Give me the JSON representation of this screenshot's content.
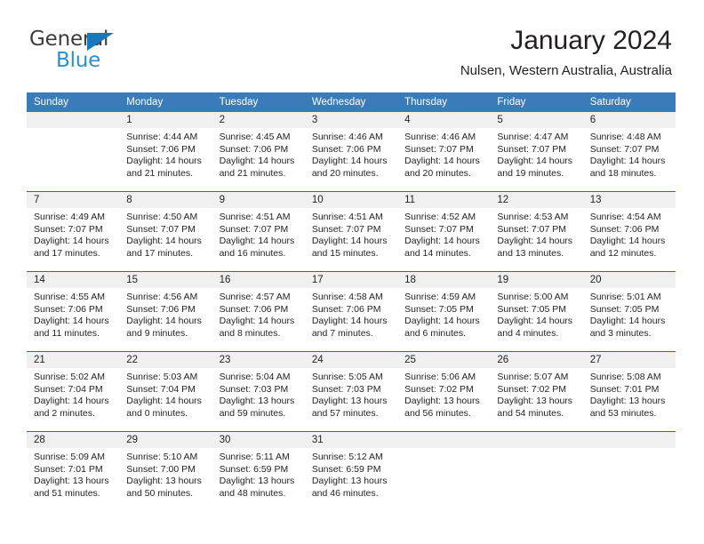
{
  "brand": {
    "name_top": "General",
    "name_bottom": "Blue",
    "logo_icon": "triangle-icon",
    "color_top": "#3d3d3d",
    "color_bottom": "#2b8fd4",
    "accent": "#1878bd"
  },
  "header": {
    "title": "January 2024",
    "subtitle": "Nulsen, Western Australia, Australia"
  },
  "theme": {
    "header_row_bg": "#3a7cba",
    "header_row_text": "#ffffff",
    "daynum_strip_bg": "#f0f0f0",
    "row_divider": "#2b6ca8",
    "body_text": "#231f20"
  },
  "weekdays": [
    "Sunday",
    "Monday",
    "Tuesday",
    "Wednesday",
    "Thursday",
    "Friday",
    "Saturday"
  ],
  "weeks": [
    [
      {
        "day": "",
        "sunrise": "",
        "sunset": "",
        "daylight_line1": "",
        "daylight_line2": ""
      },
      {
        "day": "1",
        "sunrise": "Sunrise: 4:44 AM",
        "sunset": "Sunset: 7:06 PM",
        "daylight_line1": "Daylight: 14 hours",
        "daylight_line2": "and 21 minutes."
      },
      {
        "day": "2",
        "sunrise": "Sunrise: 4:45 AM",
        "sunset": "Sunset: 7:06 PM",
        "daylight_line1": "Daylight: 14 hours",
        "daylight_line2": "and 21 minutes."
      },
      {
        "day": "3",
        "sunrise": "Sunrise: 4:46 AM",
        "sunset": "Sunset: 7:06 PM",
        "daylight_line1": "Daylight: 14 hours",
        "daylight_line2": "and 20 minutes."
      },
      {
        "day": "4",
        "sunrise": "Sunrise: 4:46 AM",
        "sunset": "Sunset: 7:07 PM",
        "daylight_line1": "Daylight: 14 hours",
        "daylight_line2": "and 20 minutes."
      },
      {
        "day": "5",
        "sunrise": "Sunrise: 4:47 AM",
        "sunset": "Sunset: 7:07 PM",
        "daylight_line1": "Daylight: 14 hours",
        "daylight_line2": "and 19 minutes."
      },
      {
        "day": "6",
        "sunrise": "Sunrise: 4:48 AM",
        "sunset": "Sunset: 7:07 PM",
        "daylight_line1": "Daylight: 14 hours",
        "daylight_line2": "and 18 minutes."
      }
    ],
    [
      {
        "day": "7",
        "sunrise": "Sunrise: 4:49 AM",
        "sunset": "Sunset: 7:07 PM",
        "daylight_line1": "Daylight: 14 hours",
        "daylight_line2": "and 17 minutes."
      },
      {
        "day": "8",
        "sunrise": "Sunrise: 4:50 AM",
        "sunset": "Sunset: 7:07 PM",
        "daylight_line1": "Daylight: 14 hours",
        "daylight_line2": "and 17 minutes."
      },
      {
        "day": "9",
        "sunrise": "Sunrise: 4:51 AM",
        "sunset": "Sunset: 7:07 PM",
        "daylight_line1": "Daylight: 14 hours",
        "daylight_line2": "and 16 minutes."
      },
      {
        "day": "10",
        "sunrise": "Sunrise: 4:51 AM",
        "sunset": "Sunset: 7:07 PM",
        "daylight_line1": "Daylight: 14 hours",
        "daylight_line2": "and 15 minutes."
      },
      {
        "day": "11",
        "sunrise": "Sunrise: 4:52 AM",
        "sunset": "Sunset: 7:07 PM",
        "daylight_line1": "Daylight: 14 hours",
        "daylight_line2": "and 14 minutes."
      },
      {
        "day": "12",
        "sunrise": "Sunrise: 4:53 AM",
        "sunset": "Sunset: 7:07 PM",
        "daylight_line1": "Daylight: 14 hours",
        "daylight_line2": "and 13 minutes."
      },
      {
        "day": "13",
        "sunrise": "Sunrise: 4:54 AM",
        "sunset": "Sunset: 7:06 PM",
        "daylight_line1": "Daylight: 14 hours",
        "daylight_line2": "and 12 minutes."
      }
    ],
    [
      {
        "day": "14",
        "sunrise": "Sunrise: 4:55 AM",
        "sunset": "Sunset: 7:06 PM",
        "daylight_line1": "Daylight: 14 hours",
        "daylight_line2": "and 11 minutes."
      },
      {
        "day": "15",
        "sunrise": "Sunrise: 4:56 AM",
        "sunset": "Sunset: 7:06 PM",
        "daylight_line1": "Daylight: 14 hours",
        "daylight_line2": "and 9 minutes."
      },
      {
        "day": "16",
        "sunrise": "Sunrise: 4:57 AM",
        "sunset": "Sunset: 7:06 PM",
        "daylight_line1": "Daylight: 14 hours",
        "daylight_line2": "and 8 minutes."
      },
      {
        "day": "17",
        "sunrise": "Sunrise: 4:58 AM",
        "sunset": "Sunset: 7:06 PM",
        "daylight_line1": "Daylight: 14 hours",
        "daylight_line2": "and 7 minutes."
      },
      {
        "day": "18",
        "sunrise": "Sunrise: 4:59 AM",
        "sunset": "Sunset: 7:05 PM",
        "daylight_line1": "Daylight: 14 hours",
        "daylight_line2": "and 6 minutes."
      },
      {
        "day": "19",
        "sunrise": "Sunrise: 5:00 AM",
        "sunset": "Sunset: 7:05 PM",
        "daylight_line1": "Daylight: 14 hours",
        "daylight_line2": "and 4 minutes."
      },
      {
        "day": "20",
        "sunrise": "Sunrise: 5:01 AM",
        "sunset": "Sunset: 7:05 PM",
        "daylight_line1": "Daylight: 14 hours",
        "daylight_line2": "and 3 minutes."
      }
    ],
    [
      {
        "day": "21",
        "sunrise": "Sunrise: 5:02 AM",
        "sunset": "Sunset: 7:04 PM",
        "daylight_line1": "Daylight: 14 hours",
        "daylight_line2": "and 2 minutes."
      },
      {
        "day": "22",
        "sunrise": "Sunrise: 5:03 AM",
        "sunset": "Sunset: 7:04 PM",
        "daylight_line1": "Daylight: 14 hours",
        "daylight_line2": "and 0 minutes."
      },
      {
        "day": "23",
        "sunrise": "Sunrise: 5:04 AM",
        "sunset": "Sunset: 7:03 PM",
        "daylight_line1": "Daylight: 13 hours",
        "daylight_line2": "and 59 minutes."
      },
      {
        "day": "24",
        "sunrise": "Sunrise: 5:05 AM",
        "sunset": "Sunset: 7:03 PM",
        "daylight_line1": "Daylight: 13 hours",
        "daylight_line2": "and 57 minutes."
      },
      {
        "day": "25",
        "sunrise": "Sunrise: 5:06 AM",
        "sunset": "Sunset: 7:02 PM",
        "daylight_line1": "Daylight: 13 hours",
        "daylight_line2": "and 56 minutes."
      },
      {
        "day": "26",
        "sunrise": "Sunrise: 5:07 AM",
        "sunset": "Sunset: 7:02 PM",
        "daylight_line1": "Daylight: 13 hours",
        "daylight_line2": "and 54 minutes."
      },
      {
        "day": "27",
        "sunrise": "Sunrise: 5:08 AM",
        "sunset": "Sunset: 7:01 PM",
        "daylight_line1": "Daylight: 13 hours",
        "daylight_line2": "and 53 minutes."
      }
    ],
    [
      {
        "day": "28",
        "sunrise": "Sunrise: 5:09 AM",
        "sunset": "Sunset: 7:01 PM",
        "daylight_line1": "Daylight: 13 hours",
        "daylight_line2": "and 51 minutes."
      },
      {
        "day": "29",
        "sunrise": "Sunrise: 5:10 AM",
        "sunset": "Sunset: 7:00 PM",
        "daylight_line1": "Daylight: 13 hours",
        "daylight_line2": "and 50 minutes."
      },
      {
        "day": "30",
        "sunrise": "Sunrise: 5:11 AM",
        "sunset": "Sunset: 6:59 PM",
        "daylight_line1": "Daylight: 13 hours",
        "daylight_line2": "and 48 minutes."
      },
      {
        "day": "31",
        "sunrise": "Sunrise: 5:12 AM",
        "sunset": "Sunset: 6:59 PM",
        "daylight_line1": "Daylight: 13 hours",
        "daylight_line2": "and 46 minutes."
      },
      {
        "day": "",
        "sunrise": "",
        "sunset": "",
        "daylight_line1": "",
        "daylight_line2": ""
      },
      {
        "day": "",
        "sunrise": "",
        "sunset": "",
        "daylight_line1": "",
        "daylight_line2": ""
      },
      {
        "day": "",
        "sunrise": "",
        "sunset": "",
        "daylight_line1": "",
        "daylight_line2": ""
      }
    ]
  ]
}
